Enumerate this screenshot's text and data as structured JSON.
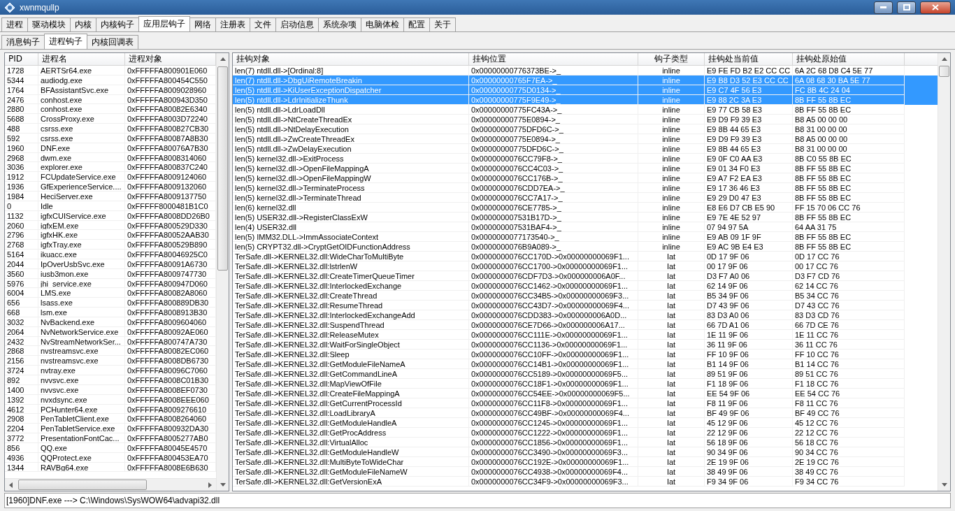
{
  "window": {
    "title": "xwnmqullp"
  },
  "tabs": [
    {
      "label": "进程",
      "selected": false
    },
    {
      "label": "驱动模块",
      "selected": false
    },
    {
      "label": "内核",
      "selected": false
    },
    {
      "label": "内核钩子",
      "selected": false
    },
    {
      "label": "应用层钩子",
      "selected": true
    },
    {
      "label": "网络",
      "selected": false
    },
    {
      "label": "注册表",
      "selected": false
    },
    {
      "label": "文件",
      "selected": false
    },
    {
      "label": "启动信息",
      "selected": false
    },
    {
      "label": "系统杂项",
      "selected": false
    },
    {
      "label": "电脑体检",
      "selected": false
    },
    {
      "label": "配置",
      "selected": false
    },
    {
      "label": "关于",
      "selected": false
    }
  ],
  "sub_tabs": [
    {
      "label": "消息钩子",
      "selected": false
    },
    {
      "label": "进程钩子",
      "selected": true
    },
    {
      "label": "内核回调表",
      "selected": false
    }
  ],
  "process_table": {
    "columns": [
      "PID",
      "进程名",
      "进程对象"
    ],
    "rows": [
      {
        "pid": "1728",
        "name": "AERTSr64.exe",
        "object": "0xFFFFFA800901E060"
      },
      {
        "pid": "5344",
        "name": "audiodg.exe",
        "object": "0xFFFFFA800454C550"
      },
      {
        "pid": "1764",
        "name": "BFAssistantSvc.exe",
        "object": "0xFFFFFA8009028960"
      },
      {
        "pid": "2476",
        "name": "conhost.exe",
        "object": "0xFFFFFA800943D350"
      },
      {
        "pid": "2880",
        "name": "conhost.exe",
        "object": "0xFFFFFA80082E6340"
      },
      {
        "pid": "5688",
        "name": "CrossProxy.exe",
        "object": "0xFFFFFA8003D72240"
      },
      {
        "pid": "488",
        "name": "csrss.exe",
        "object": "0xFFFFFA800827CB30"
      },
      {
        "pid": "592",
        "name": "csrss.exe",
        "object": "0xFFFFFA80087A8B30"
      },
      {
        "pid": "1960",
        "name": "DNF.exe",
        "object": "0xFFFFFA80076A7B30"
      },
      {
        "pid": "2968",
        "name": "dwm.exe",
        "object": "0xFFFFFA8008314060"
      },
      {
        "pid": "3036",
        "name": "explorer.exe",
        "object": "0xFFFFFA800837C240"
      },
      {
        "pid": "1912",
        "name": "FCUpdateService.exe",
        "object": "0xFFFFFA8009124060"
      },
      {
        "pid": "1936",
        "name": "GfExperienceService....",
        "object": "0xFFFFFA8009132060"
      },
      {
        "pid": "1984",
        "name": "HeciServer.exe",
        "object": "0xFFFFFA8009137750"
      },
      {
        "pid": "0",
        "name": "Idle",
        "object": "0xFFFFF8000481B1C0"
      },
      {
        "pid": "1132",
        "name": "igfxCUIService.exe",
        "object": "0xFFFFFA8008DD26B0"
      },
      {
        "pid": "2060",
        "name": "igfxEM.exe",
        "object": "0xFFFFFA800529D330"
      },
      {
        "pid": "2796",
        "name": "igfxHK.exe",
        "object": "0xFFFFFA80052AAB30"
      },
      {
        "pid": "2768",
        "name": "igfxTray.exe",
        "object": "0xFFFFFA800529B890"
      },
      {
        "pid": "5164",
        "name": "ikuacc.exe",
        "object": "0xFFFFFA80046925C0"
      },
      {
        "pid": "2044",
        "name": "IpOverUsbSvc.exe",
        "object": "0xFFFFFA80091A6730"
      },
      {
        "pid": "3560",
        "name": "iusb3mon.exe",
        "object": "0xFFFFFA8009747730"
      },
      {
        "pid": "5976",
        "name": "jhi_service.exe",
        "object": "0xFFFFFA800947D060"
      },
      {
        "pid": "6004",
        "name": "LMS.exe",
        "object": "0xFFFFFA80082A8060"
      },
      {
        "pid": "656",
        "name": "lsass.exe",
        "object": "0xFFFFFA800889DB30"
      },
      {
        "pid": "668",
        "name": "lsm.exe",
        "object": "0xFFFFFA8008913B30"
      },
      {
        "pid": "3032",
        "name": "NvBackend.exe",
        "object": "0xFFFFFA8009604060"
      },
      {
        "pid": "2064",
        "name": "NvNetworkService.exe",
        "object": "0xFFFFFA80092AE060"
      },
      {
        "pid": "2432",
        "name": "NvStreamNetworkSer...",
        "object": "0xFFFFFA800747A730"
      },
      {
        "pid": "2868",
        "name": "nvstreamsvc.exe",
        "object": "0xFFFFFA80082EC060"
      },
      {
        "pid": "2156",
        "name": "nvstreamsvc.exe",
        "object": "0xFFFFFA8008DB6730"
      },
      {
        "pid": "3724",
        "name": "nvtray.exe",
        "object": "0xFFFFFA80096C7060"
      },
      {
        "pid": "892",
        "name": "nvvsvc.exe",
        "object": "0xFFFFFA8008C01B30"
      },
      {
        "pid": "1400",
        "name": "nvvsvc.exe",
        "object": "0xFFFFFA8008EF0730"
      },
      {
        "pid": "1392",
        "name": "nvxdsync.exe",
        "object": "0xFFFFFA8008EEE060"
      },
      {
        "pid": "4612",
        "name": "PCHunter64.exe",
        "object": "0xFFFFFA8009276610"
      },
      {
        "pid": "2908",
        "name": "PenTabletClient.exe",
        "object": "0xFFFFFA8008264060"
      },
      {
        "pid": "2204",
        "name": "PenTabletService.exe",
        "object": "0xFFFFFA800932DA30"
      },
      {
        "pid": "3772",
        "name": "PresentationFontCac...",
        "object": "0xFFFFFA8005277AB0"
      },
      {
        "pid": "856",
        "name": "QQ.exe",
        "object": "0xFFFFFA80045E4570"
      },
      {
        "pid": "4936",
        "name": "QQProtect.exe",
        "object": "0xFFFFFA800453EA70"
      },
      {
        "pid": "1344",
        "name": "RAVBg64.exe",
        "object": "0xFFFFFA8008E6B630"
      }
    ]
  },
  "hook_table": {
    "columns": [
      "挂钩对象",
      "挂钩位置",
      "钩子类型",
      "挂钩处当前值",
      "挂钩处原始值"
    ],
    "rows": [
      {
        "object": "len(7) ntdll.dll->[Ordinal:8]",
        "location": "0x00000000776373BE->_",
        "type": "inline",
        "current": "E9 FE FD B2 E2 CC CC",
        "original": "6A 2C 68 D8 C4 5E 77",
        "selected": false
      },
      {
        "object": "len(7) ntdll.dll->DbgUiRemoteBreakin",
        "location": "0x00000000765F7EA->_",
        "type": "inline",
        "current": "E9 B8 D3 52 E3 CC CC",
        "original": "6A 08 68 30 BA 5E 77",
        "selected": true
      },
      {
        "object": "len(5) ntdll.dll->KiUserExceptionDispatcher",
        "location": "0x00000000775D0134->_",
        "type": "inline",
        "current": "E9 C7 4F 56 E3",
        "original": "FC 8B 4C 24 04",
        "selected": true
      },
      {
        "object": "len(5) ntdll.dll->LdrInitializeThunk",
        "location": "0x00000000775F9E49->_",
        "type": "inline",
        "current": "E9 88 2C 3A E3",
        "original": "8B FF 55 8B EC",
        "selected": true
      },
      {
        "object": "len(5) ntdll.dll->LdrLoadDll",
        "location": "0x00000000775FC43A->_",
        "type": "inline",
        "current": "E9 77 CB 58 E3",
        "original": "8B FF 55 8B EC",
        "selected": false
      },
      {
        "object": "len(5) ntdll.dll->NtCreateThreadEx",
        "location": "0x00000000775E0894->_",
        "type": "inline",
        "current": "E9 D9 F9 39 E3",
        "original": "B8 A5 00 00 00",
        "selected": false
      },
      {
        "object": "len(5) ntdll.dll->NtDelayExecution",
        "location": "0x00000000775DFD6C->_",
        "type": "inline",
        "current": "E9 8B 44 65 E3",
        "original": "B8 31 00 00 00",
        "selected": false
      },
      {
        "object": "len(5) ntdll.dll->ZwCreateThreadEx",
        "location": "0x00000000775E0894->_",
        "type": "inline",
        "current": "E9 D9 F9 39 E3",
        "original": "B8 A5 00 00 00",
        "selected": false
      },
      {
        "object": "len(5) ntdll.dll->ZwDelayExecution",
        "location": "0x00000000775DFD6C->_",
        "type": "inline",
        "current": "E9 8B 44 65 E3",
        "original": "B8 31 00 00 00",
        "selected": false
      },
      {
        "object": "len(5) kernel32.dll->ExitProcess",
        "location": "0x0000000076CC79F8->_",
        "type": "inline",
        "current": "E9 0F C0 AA E3",
        "original": "8B C0 55 8B EC",
        "selected": false
      },
      {
        "object": "len(5) kernel32.dll->OpenFileMappingA",
        "location": "0x0000000076CC4C03->_",
        "type": "inline",
        "current": "E9 01 34 F0 E3",
        "original": "8B FF 55 8B EC",
        "selected": false
      },
      {
        "object": "len(5) kernel32.dll->OpenFileMappingW",
        "location": "0x0000000076CC176B->_",
        "type": "inline",
        "current": "E9 A7 F2 EA E3",
        "original": "8B FF 55 8B EC",
        "selected": false
      },
      {
        "object": "len(5) kernel32.dll->TerminateProcess",
        "location": "0x0000000076CDD7EA->_",
        "type": "inline",
        "current": "E9 17 36 46 E3",
        "original": "8B FF 55 8B EC",
        "selected": false
      },
      {
        "object": "len(5) kernel32.dll->TerminateThread",
        "location": "0x0000000076CC7A17->_",
        "type": "inline",
        "current": "E9 29 D0 47 E3",
        "original": "8B FF 55 8B EC",
        "selected": false
      },
      {
        "object": "len(6) kernel32.dll",
        "location": "0x0000000076CE7785->_",
        "type": "inline",
        "current": "E8 E6 D7 CB E5 90",
        "original": "FF 15 70 06 CC 76",
        "selected": false
      },
      {
        "object": "len(5) USER32.dll->RegisterClassExW",
        "location": "0x000000007531B17D->_",
        "type": "inline",
        "current": "E9 7E 4E 52 97",
        "original": "8B FF 55 8B EC",
        "selected": false
      },
      {
        "object": "len(4) USER32.dll",
        "location": "0x000000007531BAF4->_",
        "type": "inline",
        "current": "07 94 97 5A",
        "original": "64 AA 31 75",
        "selected": false
      },
      {
        "object": "len(5) IMM32.DLL->ImmAssociateContext",
        "location": "0x0000000077173540->_",
        "type": "inline",
        "current": "E9 AB 09 1F 9F",
        "original": "8B FF 55 8B EC",
        "selected": false
      },
      {
        "object": "len(5) CRYPT32.dll->CryptGetOIDFunctionAddress",
        "location": "0x0000000076B9A089->_",
        "type": "inline",
        "current": "E9 AC 9B E4 E3",
        "original": "8B FF 55 8B EC",
        "selected": false
      },
      {
        "object": "TerSafe.dll->KERNEL32.dll:WideCharToMultiByte",
        "location": "0x0000000076CC170D->0x00000000069F1...",
        "type": "Iat",
        "current": "0D 17 9F 06",
        "original": "0D 17 CC 76",
        "selected": false
      },
      {
        "object": "TerSafe.dll->KERNEL32.dll:lstrlenW",
        "location": "0x0000000076CC1700->0x00000000069F1...",
        "type": "Iat",
        "current": "00 17 9F 06",
        "original": "00 17 CC 76",
        "selected": false
      },
      {
        "object": "TerSafe.dll->KERNEL32.dll:CreateTimerQueueTimer",
        "location": "0x0000000076CDF7D3->0x000000006A0F...",
        "type": "Iat",
        "current": "D3 F7 A0 06",
        "original": "D3 F7 CD 76",
        "selected": false
      },
      {
        "object": "TerSafe.dll->KERNEL32.dll:InterlockedExchange",
        "location": "0x0000000076CC1462->0x00000000069F1...",
        "type": "Iat",
        "current": "62 14 9F 06",
        "original": "62 14 CC 76",
        "selected": false
      },
      {
        "object": "TerSafe.dll->KERNEL32.dll:CreateThread",
        "location": "0x0000000076CC34B5->0x00000000069F3...",
        "type": "Iat",
        "current": "B5 34 9F 06",
        "original": "B5 34 CC 76",
        "selected": false
      },
      {
        "object": "TerSafe.dll->KERNEL32.dll:ResumeThread",
        "location": "0x0000000076CC43D7->0x00000000069F4...",
        "type": "Iat",
        "current": "D7 43 9F 06",
        "original": "D7 43 CC 76",
        "selected": false
      },
      {
        "object": "TerSafe.dll->KERNEL32.dll:InterlockedExchangeAdd",
        "location": "0x0000000076CDD383->0x000000006A0D...",
        "type": "Iat",
        "current": "83 D3 A0 06",
        "original": "83 D3 CD 76",
        "selected": false
      },
      {
        "object": "TerSafe.dll->KERNEL32.dll:SuspendThread",
        "location": "0x0000000076CE7D66->0x000000006A17...",
        "type": "Iat",
        "current": "66 7D A1 06",
        "original": "66 7D CE 76",
        "selected": false
      },
      {
        "object": "TerSafe.dll->KERNEL32.dll:ReleaseMutex",
        "location": "0x0000000076CC111E->0x00000000069F1...",
        "type": "Iat",
        "current": "1E 11 9F 06",
        "original": "1E 11 CC 76",
        "selected": false
      },
      {
        "object": "TerSafe.dll->KERNEL32.dll:WaitForSingleObject",
        "location": "0x0000000076CC1136->0x00000000069F1...",
        "type": "Iat",
        "current": "36 11 9F 06",
        "original": "36 11 CC 76",
        "selected": false
      },
      {
        "object": "TerSafe.dll->KERNEL32.dll:Sleep",
        "location": "0x0000000076CC10FF->0x00000000069F1...",
        "type": "Iat",
        "current": "FF 10 9F 06",
        "original": "FF 10 CC 76",
        "selected": false
      },
      {
        "object": "TerSafe.dll->KERNEL32.dll:GetModuleFileNameA",
        "location": "0x0000000076CC14B1->0x00000000069F1...",
        "type": "Iat",
        "current": "B1 14 9F 06",
        "original": "B1 14 CC 76",
        "selected": false
      },
      {
        "object": "TerSafe.dll->KERNEL32.dll:GetCommandLineA",
        "location": "0x0000000076CC5189->0x00000000069F5...",
        "type": "Iat",
        "current": "89 51 9F 06",
        "original": "89 51 CC 76",
        "selected": false
      },
      {
        "object": "TerSafe.dll->KERNEL32.dll:MapViewOfFile",
        "location": "0x0000000076CC18F1->0x00000000069F1...",
        "type": "Iat",
        "current": "F1 18 9F 06",
        "original": "F1 18 CC 76",
        "selected": false
      },
      {
        "object": "TerSafe.dll->KERNEL32.dll:CreateFileMappingA",
        "location": "0x0000000076CC54EE->0x00000000069F5...",
        "type": "Iat",
        "current": "EE 54 9F 06",
        "original": "EE 54 CC 76",
        "selected": false
      },
      {
        "object": "TerSafe.dll->KERNEL32.dll:GetCurrentProcessId",
        "location": "0x0000000076CC11F8->0x00000000069F1...",
        "type": "Iat",
        "current": "F8 11 9F 06",
        "original": "F8 11 CC 76",
        "selected": false
      },
      {
        "object": "TerSafe.dll->KERNEL32.dll:LoadLibraryA",
        "location": "0x0000000076CC49BF->0x00000000069F4...",
        "type": "Iat",
        "current": "BF 49 9F 06",
        "original": "BF 49 CC 76",
        "selected": false
      },
      {
        "object": "TerSafe.dll->KERNEL32.dll:GetModuleHandleA",
        "location": "0x0000000076CC1245->0x00000000069F1...",
        "type": "Iat",
        "current": "45 12 9F 06",
        "original": "45 12 CC 76",
        "selected": false
      },
      {
        "object": "TerSafe.dll->KERNEL32.dll:GetProcAddress",
        "location": "0x0000000076CC1222->0x00000000069F1...",
        "type": "Iat",
        "current": "22 12 9F 06",
        "original": "22 12 CC 76",
        "selected": false
      },
      {
        "object": "TerSafe.dll->KERNEL32.dll:VirtualAlloc",
        "location": "0x0000000076CC1856->0x00000000069F1...",
        "type": "Iat",
        "current": "56 18 9F 06",
        "original": "56 18 CC 76",
        "selected": false
      },
      {
        "object": "TerSafe.dll->KERNEL32.dll:GetModuleHandleW",
        "location": "0x0000000076CC3490->0x00000000069F3...",
        "type": "Iat",
        "current": "90 34 9F 06",
        "original": "90 34 CC 76",
        "selected": false
      },
      {
        "object": "TerSafe.dll->KERNEL32.dll:MultiByteToWideChar",
        "location": "0x0000000076CC192E->0x00000000069F1...",
        "type": "Iat",
        "current": "2E 19 9F 06",
        "original": "2E 19 CC 76",
        "selected": false
      },
      {
        "object": "TerSafe.dll->KERNEL32.dll:GetModuleFileNameW",
        "location": "0x0000000076CC4938->0x00000000069F4...",
        "type": "Iat",
        "current": "38 49 9F 06",
        "original": "38 49 CC 76",
        "selected": false
      },
      {
        "object": "TerSafe.dll->KERNEL32.dll:GetVersionExA",
        "location": "0x0000000076CC34F9->0x00000000069F3...",
        "type": "Iat",
        "current": "F9 34 9F 06",
        "original": "F9 34 CC 76",
        "selected": false
      }
    ]
  },
  "status_bar": {
    "text": "[1960]DNF.exe ---> C:\\Windows\\SysWOW64\\advapi32.dll"
  }
}
